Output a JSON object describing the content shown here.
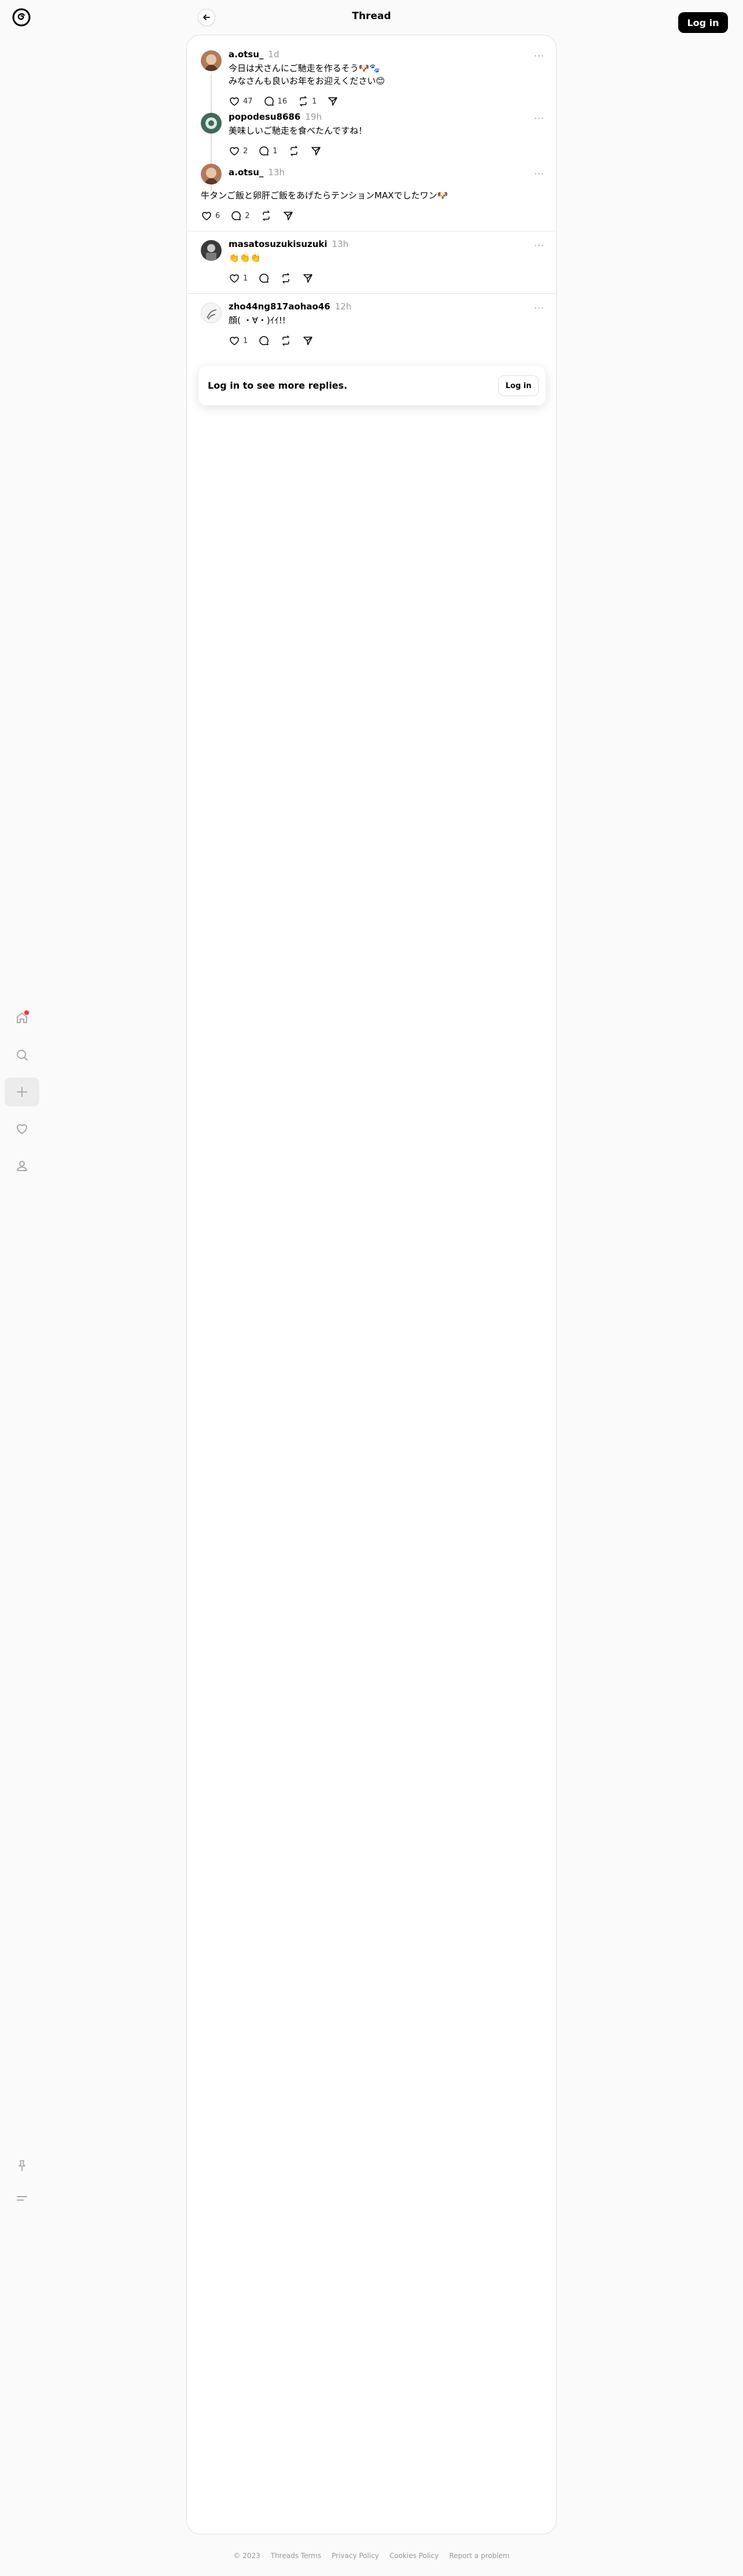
{
  "header": {
    "title": "Thread",
    "login_label": "Log in"
  },
  "sidebar": {
    "items": [
      {
        "icon": "home-icon"
      },
      {
        "icon": "search-icon"
      },
      {
        "icon": "create-icon"
      },
      {
        "icon": "heart-icon"
      },
      {
        "icon": "profile-icon"
      }
    ],
    "bottom": [
      {
        "icon": "pin-icon"
      },
      {
        "icon": "menu-icon"
      }
    ]
  },
  "posts": [
    {
      "username": "a.otsu_",
      "time": "1d",
      "text": "今日は犬さんにご馳走を作るそう🐶🐾\nみなさんも良いお年をお迎えください😊",
      "likes": "47",
      "replies": "16",
      "reposts": "1"
    },
    {
      "username": "popodesu8686",
      "time": "19h",
      "text": "美味しいご馳走を食べたんですね！",
      "likes": "2",
      "replies": "1",
      "reposts": ""
    },
    {
      "username": "a.otsu_",
      "time": "13h",
      "text": "牛タンご飯と卵肝ご飯をあげたらテンションMAXでしたワン🐶",
      "likes": "6",
      "replies": "2",
      "reposts": ""
    },
    {
      "username": "masatosuzukisuzuki",
      "time": "13h",
      "text": "👏👏👏",
      "likes": "1",
      "replies": "",
      "reposts": ""
    },
    {
      "username": "zho44ng817aohao46",
      "time": "12h",
      "text": "顔( ・∀・)ｲｲ!!",
      "likes": "1",
      "replies": "",
      "reposts": ""
    }
  ],
  "login_prompt": {
    "text": "Log in to see more replies.",
    "button": "Log in"
  },
  "footer": {
    "copyright": "© 2023",
    "links": [
      "Threads Terms",
      "Privacy Policy",
      "Cookies Policy",
      "Report a problem"
    ]
  }
}
